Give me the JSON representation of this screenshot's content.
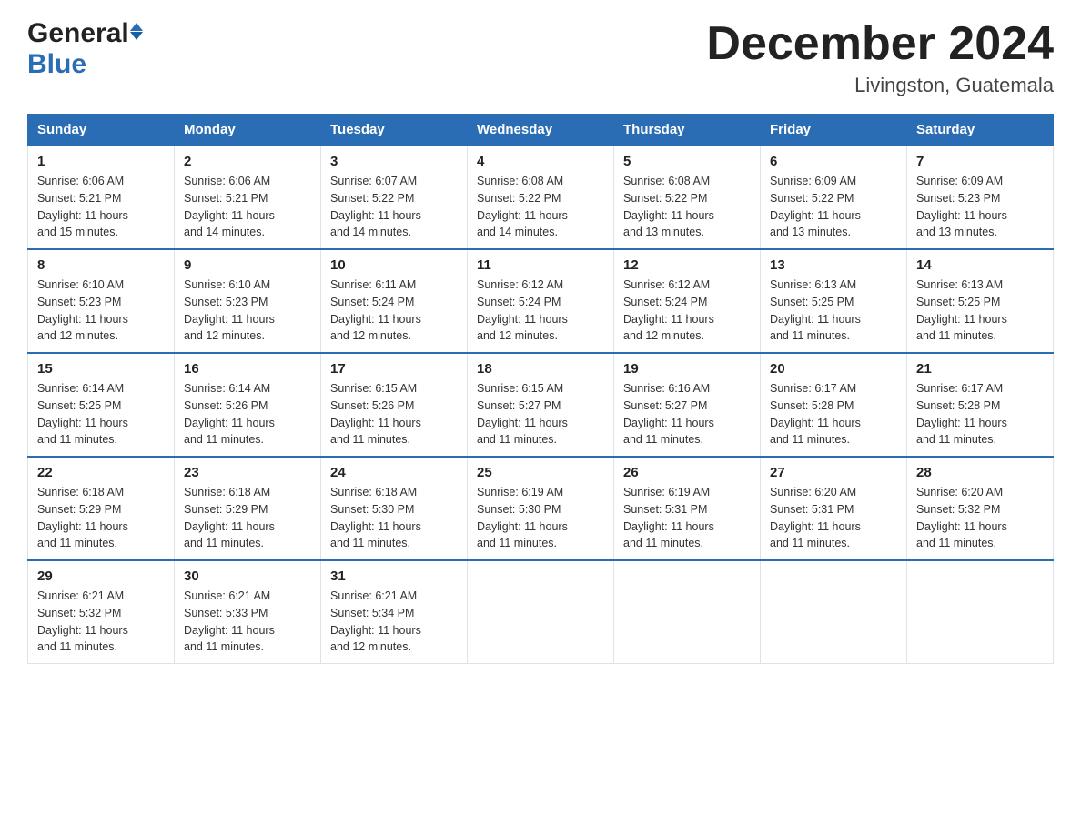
{
  "header": {
    "logo_general": "General",
    "logo_blue": "Blue",
    "title": "December 2024",
    "subtitle": "Livingston, Guatemala"
  },
  "days_of_week": [
    "Sunday",
    "Monday",
    "Tuesday",
    "Wednesday",
    "Thursday",
    "Friday",
    "Saturday"
  ],
  "weeks": [
    [
      {
        "day": "1",
        "info": "Sunrise: 6:06 AM\nSunset: 5:21 PM\nDaylight: 11 hours\nand 15 minutes."
      },
      {
        "day": "2",
        "info": "Sunrise: 6:06 AM\nSunset: 5:21 PM\nDaylight: 11 hours\nand 14 minutes."
      },
      {
        "day": "3",
        "info": "Sunrise: 6:07 AM\nSunset: 5:22 PM\nDaylight: 11 hours\nand 14 minutes."
      },
      {
        "day": "4",
        "info": "Sunrise: 6:08 AM\nSunset: 5:22 PM\nDaylight: 11 hours\nand 14 minutes."
      },
      {
        "day": "5",
        "info": "Sunrise: 6:08 AM\nSunset: 5:22 PM\nDaylight: 11 hours\nand 13 minutes."
      },
      {
        "day": "6",
        "info": "Sunrise: 6:09 AM\nSunset: 5:22 PM\nDaylight: 11 hours\nand 13 minutes."
      },
      {
        "day": "7",
        "info": "Sunrise: 6:09 AM\nSunset: 5:23 PM\nDaylight: 11 hours\nand 13 minutes."
      }
    ],
    [
      {
        "day": "8",
        "info": "Sunrise: 6:10 AM\nSunset: 5:23 PM\nDaylight: 11 hours\nand 12 minutes."
      },
      {
        "day": "9",
        "info": "Sunrise: 6:10 AM\nSunset: 5:23 PM\nDaylight: 11 hours\nand 12 minutes."
      },
      {
        "day": "10",
        "info": "Sunrise: 6:11 AM\nSunset: 5:24 PM\nDaylight: 11 hours\nand 12 minutes."
      },
      {
        "day": "11",
        "info": "Sunrise: 6:12 AM\nSunset: 5:24 PM\nDaylight: 11 hours\nand 12 minutes."
      },
      {
        "day": "12",
        "info": "Sunrise: 6:12 AM\nSunset: 5:24 PM\nDaylight: 11 hours\nand 12 minutes."
      },
      {
        "day": "13",
        "info": "Sunrise: 6:13 AM\nSunset: 5:25 PM\nDaylight: 11 hours\nand 11 minutes."
      },
      {
        "day": "14",
        "info": "Sunrise: 6:13 AM\nSunset: 5:25 PM\nDaylight: 11 hours\nand 11 minutes."
      }
    ],
    [
      {
        "day": "15",
        "info": "Sunrise: 6:14 AM\nSunset: 5:25 PM\nDaylight: 11 hours\nand 11 minutes."
      },
      {
        "day": "16",
        "info": "Sunrise: 6:14 AM\nSunset: 5:26 PM\nDaylight: 11 hours\nand 11 minutes."
      },
      {
        "day": "17",
        "info": "Sunrise: 6:15 AM\nSunset: 5:26 PM\nDaylight: 11 hours\nand 11 minutes."
      },
      {
        "day": "18",
        "info": "Sunrise: 6:15 AM\nSunset: 5:27 PM\nDaylight: 11 hours\nand 11 minutes."
      },
      {
        "day": "19",
        "info": "Sunrise: 6:16 AM\nSunset: 5:27 PM\nDaylight: 11 hours\nand 11 minutes."
      },
      {
        "day": "20",
        "info": "Sunrise: 6:17 AM\nSunset: 5:28 PM\nDaylight: 11 hours\nand 11 minutes."
      },
      {
        "day": "21",
        "info": "Sunrise: 6:17 AM\nSunset: 5:28 PM\nDaylight: 11 hours\nand 11 minutes."
      }
    ],
    [
      {
        "day": "22",
        "info": "Sunrise: 6:18 AM\nSunset: 5:29 PM\nDaylight: 11 hours\nand 11 minutes."
      },
      {
        "day": "23",
        "info": "Sunrise: 6:18 AM\nSunset: 5:29 PM\nDaylight: 11 hours\nand 11 minutes."
      },
      {
        "day": "24",
        "info": "Sunrise: 6:18 AM\nSunset: 5:30 PM\nDaylight: 11 hours\nand 11 minutes."
      },
      {
        "day": "25",
        "info": "Sunrise: 6:19 AM\nSunset: 5:30 PM\nDaylight: 11 hours\nand 11 minutes."
      },
      {
        "day": "26",
        "info": "Sunrise: 6:19 AM\nSunset: 5:31 PM\nDaylight: 11 hours\nand 11 minutes."
      },
      {
        "day": "27",
        "info": "Sunrise: 6:20 AM\nSunset: 5:31 PM\nDaylight: 11 hours\nand 11 minutes."
      },
      {
        "day": "28",
        "info": "Sunrise: 6:20 AM\nSunset: 5:32 PM\nDaylight: 11 hours\nand 11 minutes."
      }
    ],
    [
      {
        "day": "29",
        "info": "Sunrise: 6:21 AM\nSunset: 5:32 PM\nDaylight: 11 hours\nand 11 minutes."
      },
      {
        "day": "30",
        "info": "Sunrise: 6:21 AM\nSunset: 5:33 PM\nDaylight: 11 hours\nand 11 minutes."
      },
      {
        "day": "31",
        "info": "Sunrise: 6:21 AM\nSunset: 5:34 PM\nDaylight: 11 hours\nand 12 minutes."
      },
      {
        "day": "",
        "info": ""
      },
      {
        "day": "",
        "info": ""
      },
      {
        "day": "",
        "info": ""
      },
      {
        "day": "",
        "info": ""
      }
    ]
  ]
}
